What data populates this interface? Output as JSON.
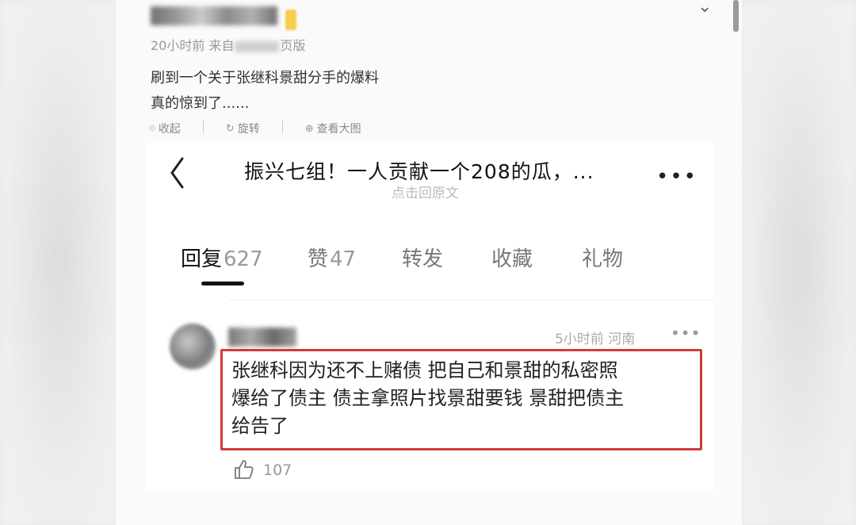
{
  "post": {
    "time": "20小时前",
    "source_prefix": "来自",
    "source_suffix": "页版",
    "line1": "刷到一个关于张继科景甜分手的爆料",
    "line2": "真的惊到了......",
    "actions": [
      {
        "label": "收起",
        "icon": "collapse-icon"
      },
      {
        "label": "旋转",
        "icon": "rotate-icon"
      },
      {
        "label": "查看大图",
        "icon": "zoom-icon"
      }
    ]
  },
  "thread": {
    "title": "振兴七组！一人贡献一个208的瓜，...",
    "subtitle": "点击回原文",
    "tabs": [
      {
        "label": "回复",
        "count": "627",
        "active": true
      },
      {
        "label": "赞",
        "count": "47",
        "active": false
      },
      {
        "label": "转发",
        "count": "",
        "active": false
      },
      {
        "label": "收藏",
        "count": "",
        "active": false
      },
      {
        "label": "礼物",
        "count": "",
        "active": false
      }
    ]
  },
  "comment": {
    "time": "5小时前",
    "location": "河南",
    "lines": [
      "张继科因为还不上赌债 把自己和景甜的私密照",
      "爆给了债主 债主拿照片找景甜要钱 景甜把债主",
      "给告了"
    ],
    "like_count": "107"
  },
  "colors": {
    "highlight_border": "#d23b3b",
    "badge": "#f3cf49"
  }
}
